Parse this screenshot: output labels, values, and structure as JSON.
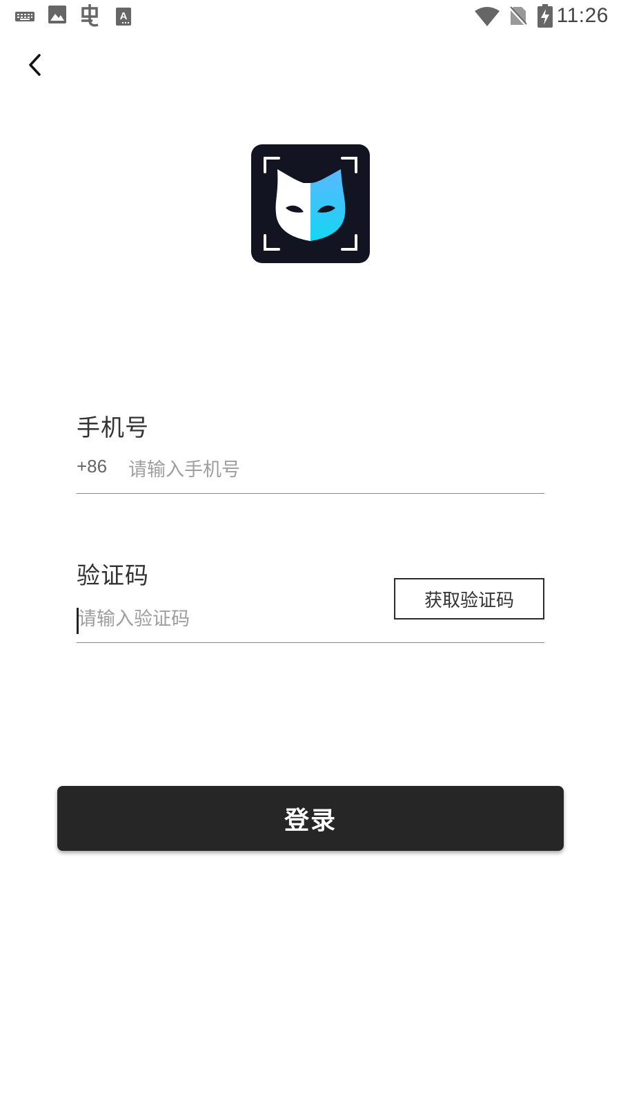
{
  "status_bar": {
    "time": "11:26",
    "left_icons": [
      "keyboard-icon",
      "image-icon",
      "bug-icon",
      "text-a-icon"
    ],
    "right_icons": [
      "wifi-icon",
      "no-sim-icon",
      "battery-charging-icon"
    ]
  },
  "header": {
    "back_icon": "chevron-left-icon"
  },
  "logo": {
    "icon": "cat-mask-icon",
    "colors": {
      "background": "#121421",
      "left": "#ffffff",
      "right_gradient": [
        "#5ab8ff",
        "#1ad9f5"
      ]
    }
  },
  "form": {
    "phone": {
      "label": "手机号",
      "country_code": "+86",
      "placeholder": "请输入手机号",
      "value": ""
    },
    "code": {
      "label": "验证码",
      "placeholder": "请输入验证码",
      "value": "",
      "get_code_label": "获取验证码"
    },
    "login_label": "登录"
  },
  "colors": {
    "login_button": "#262626",
    "text": "#333333",
    "placeholder": "#9e9e9e",
    "divider": "#888888"
  }
}
